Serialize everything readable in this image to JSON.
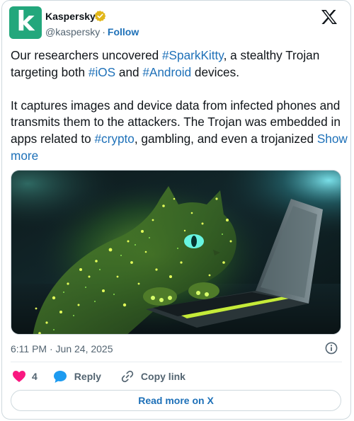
{
  "author": {
    "name": "Kaspersky",
    "handle": "@kaspersky",
    "separator": "·",
    "follow_label": "Follow",
    "avatar_letter": "k",
    "avatar_color": "#23a77c",
    "verified_color": "#e2b719"
  },
  "brand_icon": "x-logo-icon",
  "tweet": {
    "p1_part1": "Our researchers uncovered ",
    "p1_tag1": "#SparkKitty",
    "p1_part2": ", a stealthy Trojan targeting both ",
    "p1_tag2": "#iOS",
    "p1_part3": " and ",
    "p1_tag3": "#Android",
    "p1_part4": " devices.",
    "p2_part1": "It captures images and device data from infected phones and transmits them to the attackers. The Trojan was embedded in apps related to ",
    "p2_tag1": "#crypto",
    "p2_part2": ", gambling, and even a trojanized ",
    "show_more": "Show more"
  },
  "timestamp": "6:11 PM · Jun 24, 2025",
  "actions": {
    "like_count": "4",
    "reply_label": "Reply",
    "copy_label": "Copy link"
  },
  "read_more_label": "Read more on X",
  "colors": {
    "link": "#1d70b8",
    "like": "#f91880",
    "muted": "#536471"
  }
}
